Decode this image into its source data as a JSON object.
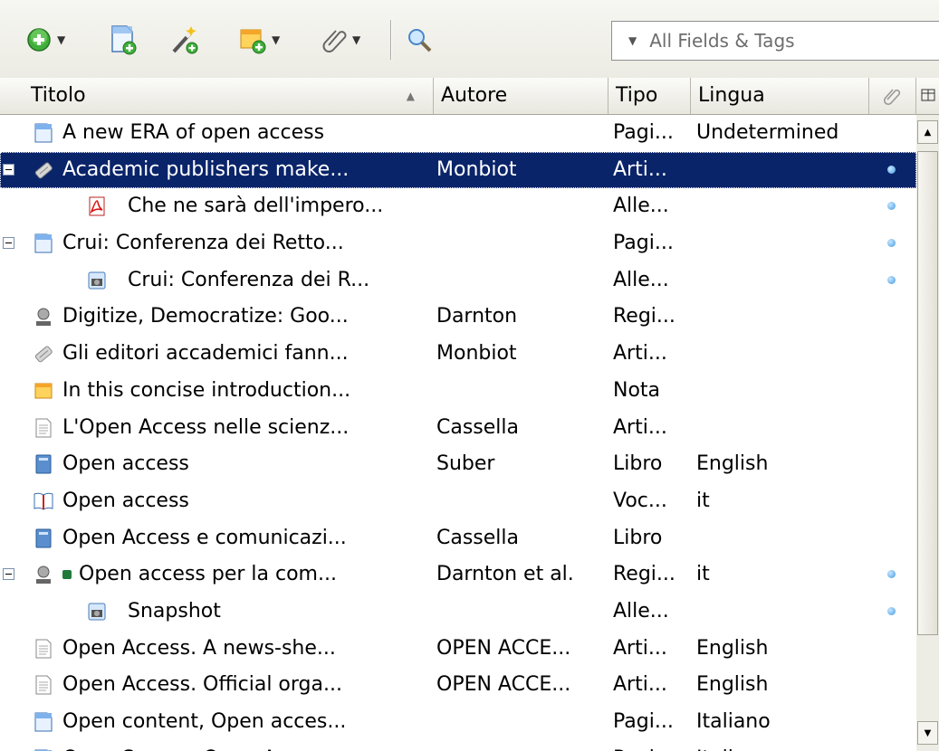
{
  "toolbar": {
    "new_item_icon": "green-plus-icon",
    "new_note_icon": "new-document-icon",
    "add_by_identifier_icon": "magic-wand-icon",
    "new_note_dropdown_icon": "new-note-icon",
    "attachment_icon": "paperclip-icon",
    "search_icon": "magnifier-icon",
    "search_placeholder": "All Fields & Tags"
  },
  "columns": {
    "title": "Titolo",
    "author": "Autore",
    "type": "Tipo",
    "language": "Lingua"
  },
  "rows": [
    {
      "title": "A new ERA of open access",
      "author": "",
      "type": "Pagi...",
      "language": "Undetermined",
      "icon": "webpage-icon"
    },
    {
      "title": "Academic publishers make...",
      "author": "Monbiot",
      "type": "Arti...",
      "language": "",
      "icon": "newspaper-article-icon"
    },
    {
      "title": "Che ne sarà dell'impero...",
      "author": "",
      "type": "Alle...",
      "language": "",
      "icon": "pdf-icon"
    },
    {
      "title": "Crui: Conferenza dei Retto...",
      "author": "",
      "type": "Pagi...",
      "language": "",
      "icon": "webpage-icon"
    },
    {
      "title": "Crui: Conferenza dei R...",
      "author": "",
      "type": "Alle...",
      "language": "",
      "icon": "snapshot-icon"
    },
    {
      "title": "Digitize, Democratize: Goo...",
      "author": "Darnton",
      "type": "Regi...",
      "language": "",
      "icon": "podcast-icon"
    },
    {
      "title": "Gli editori accademici fann...",
      "author": "Monbiot",
      "type": "Arti...",
      "language": "",
      "icon": "newspaper-article-icon"
    },
    {
      "title": "In this concise introduction...",
      "author": "",
      "type": "Nota",
      "language": "",
      "icon": "note-icon"
    },
    {
      "title": "L'Open Access nelle scienz...",
      "author": "Cassella",
      "type": "Arti...",
      "language": "",
      "icon": "journal-article-icon"
    },
    {
      "title": "Open access",
      "author": "Suber",
      "type": "Libro",
      "language": "English",
      "icon": "book-icon"
    },
    {
      "title": "Open access",
      "author": "",
      "type": "Voc...",
      "language": "it",
      "icon": "encyclopedia-icon"
    },
    {
      "title": "Open Access e comunicazi...",
      "author": "Cassella",
      "type": "Libro",
      "language": "",
      "icon": "book-icon"
    },
    {
      "title": "Open access per la com...",
      "author": "Darnton et al.",
      "type": "Regi...",
      "language": "it",
      "icon": "podcast-icon"
    },
    {
      "title": "Snapshot",
      "author": "",
      "type": "Alle...",
      "language": "",
      "icon": "snapshot-icon"
    },
    {
      "title": "Open Access. A news-she...",
      "author": "OPEN ACCE...",
      "type": "Arti...",
      "language": "English",
      "icon": "journal-article-icon"
    },
    {
      "title": "Open Access. Official orga...",
      "author": "OPEN ACCE...",
      "type": "Arti...",
      "language": "English",
      "icon": "journal-article-icon"
    },
    {
      "title": "Open content, Open acces...",
      "author": "",
      "type": "Pagi...",
      "language": "Italiano",
      "icon": "webpage-icon"
    },
    {
      "title": "Open Source, Open Acces...",
      "author": "",
      "type": "Pagi...",
      "language": "Italiano",
      "icon": "webpage-icon"
    }
  ],
  "colors": {
    "selection": "#0a246a",
    "tag_green": "#1f7a3a"
  }
}
